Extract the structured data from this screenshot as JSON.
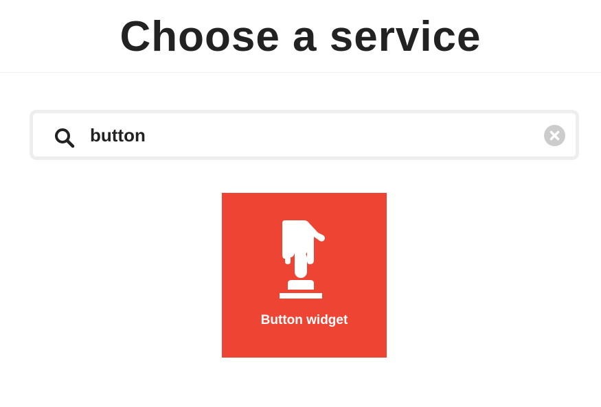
{
  "header": {
    "title": "Choose a service"
  },
  "search": {
    "value": "button",
    "icon": "search-icon",
    "clear_icon": "clear-icon"
  },
  "results": [
    {
      "label": "Button widget",
      "icon": "button-press-icon",
      "color": "#ee4433"
    }
  ],
  "colors": {
    "title": "#222222",
    "tile": "#ee4433",
    "search_border": "#eeeeee",
    "clear_icon": "#cccccc"
  }
}
